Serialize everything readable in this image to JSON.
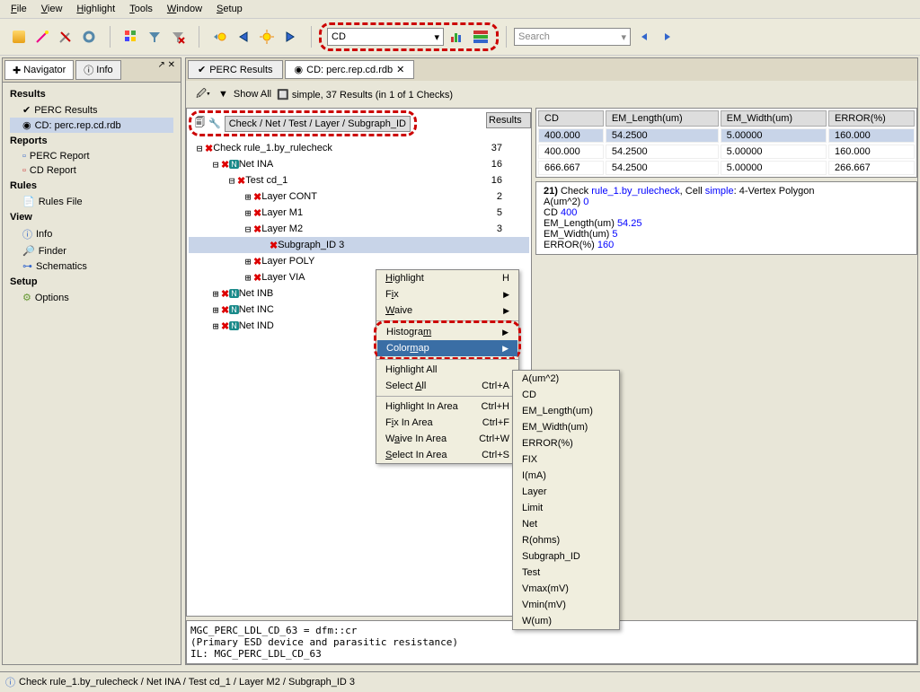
{
  "menu": [
    "File",
    "View",
    "Highlight",
    "Tools",
    "Window",
    "Setup"
  ],
  "cd_dropdown": "CD",
  "search_placeholder": "Search",
  "left_tabs": {
    "navigator": "Navigator",
    "info": "Info"
  },
  "nav": {
    "results_hdr": "Results",
    "perc_results": "PERC Results",
    "cd_rdb": "CD: perc.rep.cd.rdb",
    "reports_hdr": "Reports",
    "perc_report": "PERC Report",
    "cd_report": "CD Report",
    "rules_hdr": "Rules",
    "rules_file": "Rules File",
    "view_hdr": "View",
    "info": "Info",
    "finder": "Finder",
    "schematics": "Schematics",
    "setup_hdr": "Setup",
    "options": "Options"
  },
  "right_tabs": {
    "perc": "PERC Results",
    "cd": "CD: perc.rep.cd.rdb"
  },
  "filter": {
    "show_all": "Show All",
    "summary": "simple, 37 Results (in 1 of 1 Checks)"
  },
  "tree_header": "Check / Net / Test / Layer / Subgraph_ID",
  "results_header": "Results",
  "tree": [
    {
      "indent": 0,
      "exp": "⊟",
      "x": true,
      "label": "Check rule_1.by_rulecheck",
      "res": "37"
    },
    {
      "indent": 1,
      "exp": "⊟",
      "x": true,
      "n": true,
      "label": "Net INA",
      "res": "16"
    },
    {
      "indent": 2,
      "exp": "⊟",
      "x": true,
      "label": "Test cd_1",
      "res": "16"
    },
    {
      "indent": 3,
      "exp": "⊞",
      "x": true,
      "label": "Layer CONT",
      "res": "2"
    },
    {
      "indent": 3,
      "exp": "⊞",
      "x": true,
      "label": "Layer M1",
      "res": "5"
    },
    {
      "indent": 3,
      "exp": "⊟",
      "x": true,
      "label": "Layer M2",
      "res": "3"
    },
    {
      "indent": 4,
      "exp": "",
      "x": true,
      "label": "Subgraph_ID 3",
      "res": "",
      "sel": true
    },
    {
      "indent": 3,
      "exp": "⊞",
      "x": true,
      "label": "Layer POLY",
      "res": ""
    },
    {
      "indent": 3,
      "exp": "⊞",
      "x": true,
      "label": "Layer VIA",
      "res": ""
    },
    {
      "indent": 1,
      "exp": "⊞",
      "x": true,
      "n": true,
      "label": "Net INB",
      "res": ""
    },
    {
      "indent": 1,
      "exp": "⊞",
      "x": true,
      "n": true,
      "label": "Net INC",
      "res": ""
    },
    {
      "indent": 1,
      "exp": "⊞",
      "x": true,
      "n": true,
      "label": "Net IND",
      "res": ""
    }
  ],
  "table": {
    "cols": [
      "CD",
      "EM_Length(um)",
      "EM_Width(um)",
      "ERROR(%)"
    ],
    "rows": [
      [
        "400.000",
        "54.2500",
        "5.00000",
        "160.000"
      ],
      [
        "400.000",
        "54.2500",
        "5.00000",
        "160.000"
      ],
      [
        "666.667",
        "54.2500",
        "5.00000",
        "266.667"
      ]
    ]
  },
  "detail": {
    "title_num": "21)",
    "title_check": "Check ",
    "title_rule": "rule_1.by_rulecheck",
    "title_cell": ", Cell ",
    "title_simple": "simple",
    "title_suffix": ": 4-Vertex Polygon",
    "rows": [
      {
        "k": "A(um^2)",
        "v": "0"
      },
      {
        "k": "CD",
        "v": "400"
      },
      {
        "k": "EM_Length(um)",
        "v": "54.25"
      },
      {
        "k": "EM_Width(um)",
        "v": "5"
      },
      {
        "k": "ERROR(%)",
        "v": "160"
      }
    ]
  },
  "bottom": "MGC_PERC_LDL_CD_63 = dfm::cr\n(Primary ESD device and parasitic resistance)\nIL: MGC_PERC_LDL_CD_63",
  "status": "Check rule_1.by_rulecheck / Net INA / Test cd_1 / Layer M2 / Subgraph_ID 3",
  "ctx": {
    "highlight": "Highlight",
    "fix": "Fix",
    "waive": "Waive",
    "histogram": "Histogram",
    "colormap": "Colormap",
    "highlight_all": "Highlight All",
    "select_all": "Select All",
    "highlight_area": "Highlight In Area",
    "fix_area": "Fix In Area",
    "waive_area": "Waive In Area",
    "select_area": "Select In Area",
    "sc_h": "H",
    "sc_ca": "Ctrl+A",
    "sc_ch": "Ctrl+H",
    "sc_cf": "Ctrl+F",
    "sc_cw": "Ctrl+W",
    "sc_cs": "Ctrl+S"
  },
  "submenu": [
    "A(um^2)",
    "CD",
    "EM_Length(um)",
    "EM_Width(um)",
    "ERROR(%)",
    "FIX",
    "I(mA)",
    "Layer",
    "Limit",
    "Net",
    "R(ohms)",
    "Subgraph_ID",
    "Test",
    "Vmax(mV)",
    "Vmin(mV)",
    "W(um)"
  ]
}
